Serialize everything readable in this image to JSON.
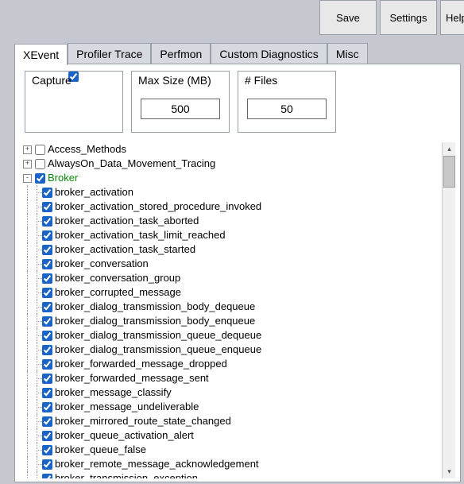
{
  "toolbar": {
    "save": "Save",
    "settings": "Settings",
    "help": "Help"
  },
  "tabs": {
    "xevent": "XEvent",
    "profiler": "Profiler Trace",
    "perfmon": "Perfmon",
    "custom": "Custom Diagnostics",
    "misc": "Misc"
  },
  "capture": {
    "label": "Capture",
    "checked": true
  },
  "maxsize": {
    "label": "Max Size (MB)",
    "value": "500"
  },
  "files": {
    "label": "# Files",
    "value": "50"
  },
  "tree": {
    "access_methods": "Access_Methods",
    "alwayson": "AlwaysOn_Data_Movement_Tracing",
    "broker": "Broker",
    "items": [
      "broker_activation",
      "broker_activation_stored_procedure_invoked",
      "broker_activation_task_aborted",
      "broker_activation_task_limit_reached",
      "broker_activation_task_started",
      "broker_conversation",
      "broker_conversation_group",
      "broker_corrupted_message",
      "broker_dialog_transmission_body_dequeue",
      "broker_dialog_transmission_body_enqueue",
      "broker_dialog_transmission_queue_dequeue",
      "broker_dialog_transmission_queue_enqueue",
      "broker_forwarded_message_dropped",
      "broker_forwarded_message_sent",
      "broker_message_classify",
      "broker_message_undeliverable",
      "broker_mirrored_route_state_changed",
      "broker_queue_activation_alert",
      "broker_queue_false",
      "broker_remote_message_acknowledgement",
      "broker_transmission_exception"
    ]
  }
}
